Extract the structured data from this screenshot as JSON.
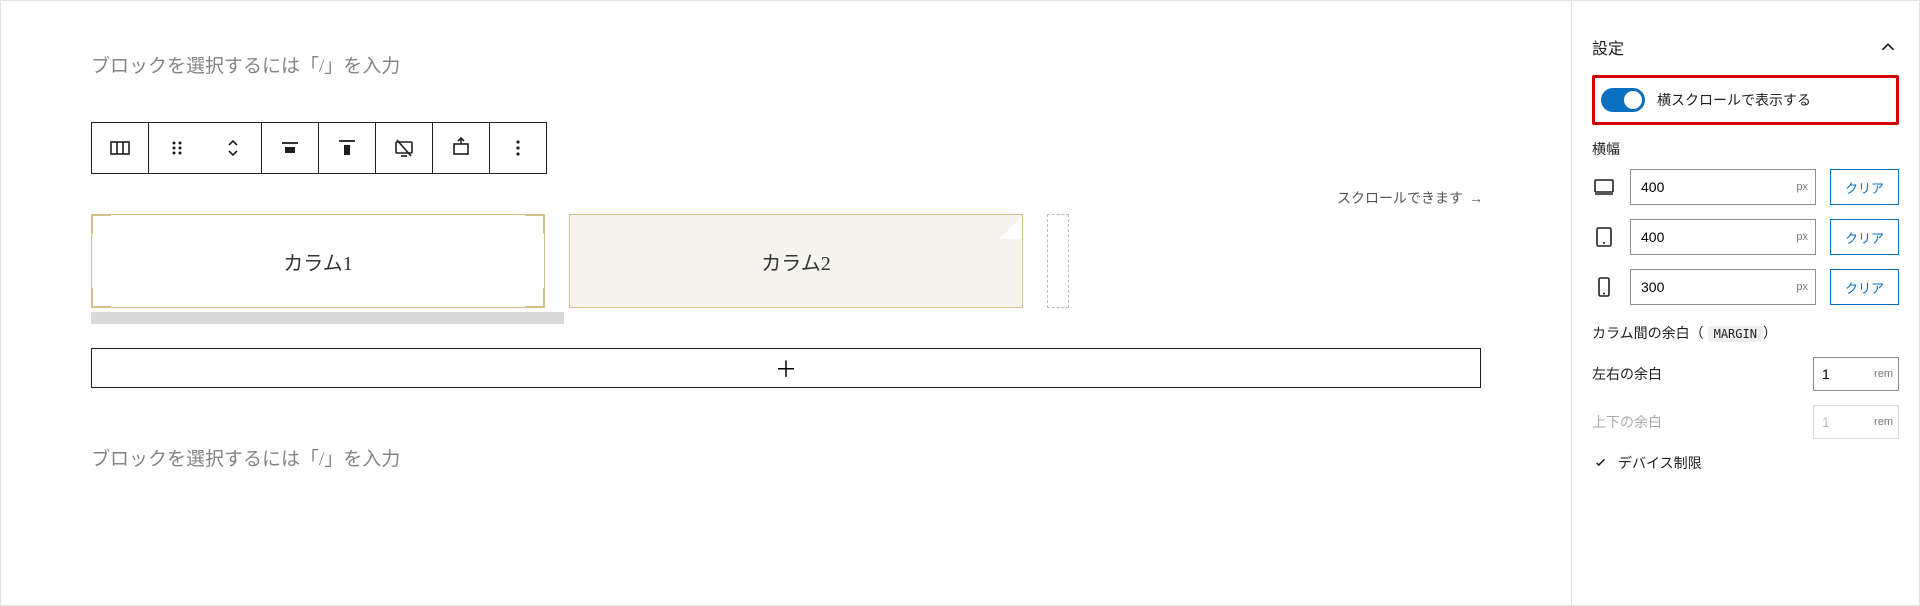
{
  "editor": {
    "placeholder": "ブロックを選択するには「/」を入力",
    "scroll_hint": "スクロールできます",
    "columns": [
      {
        "label": "カラム1"
      },
      {
        "label": "カラム2"
      }
    ],
    "appender_symbol": "＋"
  },
  "sidebar": {
    "panel_title": "設定",
    "toggle_label": "横スクロールで表示する",
    "width_label": "横幅",
    "unit_px": "px",
    "unit_rem": "rem",
    "clear_label": "クリア",
    "widths": {
      "desktop": "400",
      "tablet": "400",
      "mobile": "300"
    },
    "margin_heading": "カラム間の余白（",
    "margin_badge": "MARGIN",
    "margin_heading_close": "）",
    "margin_lr_label": "左右の余白",
    "margin_lr_value": "1",
    "margin_tb_label": "上下の余白",
    "margin_tb_value": "1",
    "device_limit_label": "デバイス制限"
  }
}
